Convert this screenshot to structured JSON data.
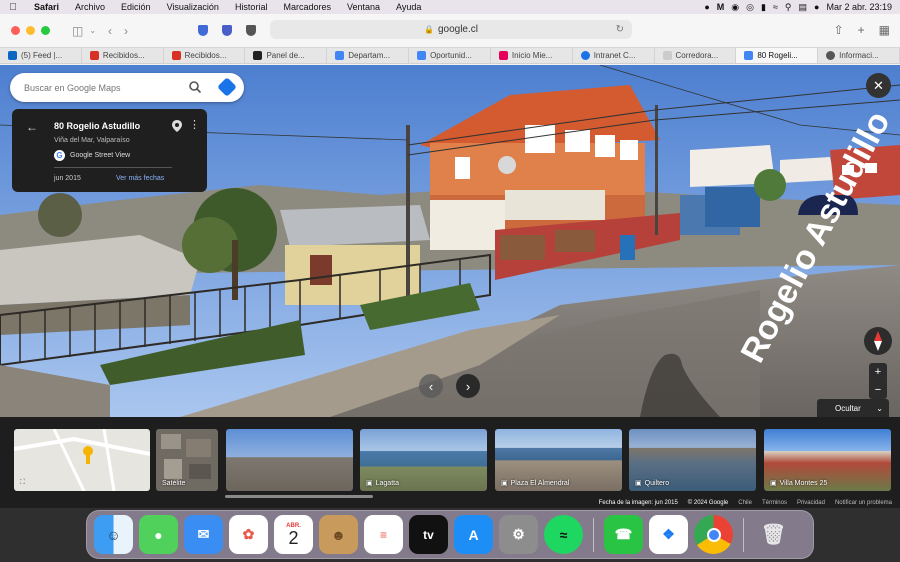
{
  "menubar": {
    "app_name": "Safari",
    "menus": [
      "Archivo",
      "Edición",
      "Visualización",
      "Historial",
      "Marcadores",
      "Ventana",
      "Ayuda"
    ],
    "datetime": "Mar 2 abr.  23:19"
  },
  "browser": {
    "url": "google.cl",
    "tabs": [
      {
        "label": "(5) Feed |...",
        "icon_color": "#0a66c2"
      },
      {
        "label": "Recibidos...",
        "icon_color": "#d93025"
      },
      {
        "label": "Recibidos...",
        "icon_color": "#d93025"
      },
      {
        "label": "Panel de...",
        "icon_color": "#222222"
      },
      {
        "label": "Departam...",
        "icon_color": "#4285f4"
      },
      {
        "label": "Oportunid...",
        "icon_color": "#4285f4"
      },
      {
        "label": "Inicio Mie...",
        "icon_color": "#e5005a"
      },
      {
        "label": "Intranet C...",
        "icon_color": "#1a73e8"
      },
      {
        "label": "Corredora...",
        "icon_color": "#cccccc"
      },
      {
        "label": "80 Rogeli...",
        "icon_color": "#4285f4"
      },
      {
        "label": "Informaci...",
        "icon_color": "#555555"
      }
    ]
  },
  "maps": {
    "search_placeholder": "Buscar en Google Maps",
    "place": {
      "title": "80 Rogelio Astudillo",
      "subtitle": "Viña del Mar, Valparaíso",
      "source": "Google Street View",
      "date": "jun 2015",
      "more_dates": "Ver más fechas"
    },
    "hide_label": "Ocultar",
    "thumbnails": [
      {
        "label": ""
      },
      {
        "label": "Satélite"
      },
      {
        "label": ""
      },
      {
        "label": "Lagatta"
      },
      {
        "label": "Plaza El Almendral"
      },
      {
        "label": "Quiltero"
      },
      {
        "label": "Villa Montes 25"
      }
    ],
    "footer": [
      "Fecha de la imagen: jun 2015",
      "© 2024 Google",
      "Chile",
      "Términos",
      "Privacidad",
      "Notificar un problema"
    ],
    "street_text": "Rogelio Astudillo"
  },
  "dock": {
    "calendar_month": "ABR.",
    "calendar_day": "2",
    "tv_label": "tv"
  }
}
